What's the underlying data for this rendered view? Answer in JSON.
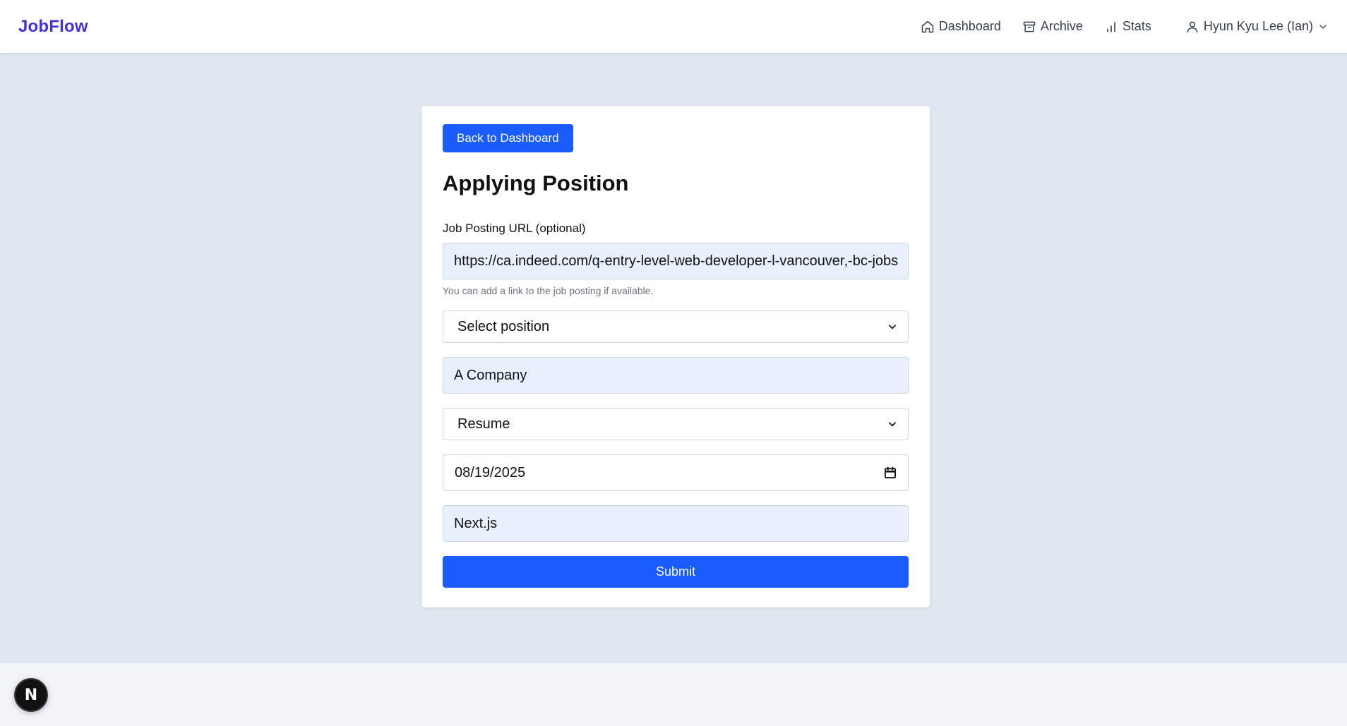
{
  "app": {
    "brand": "JobFlow"
  },
  "nav": {
    "dashboard": "Dashboard",
    "archive": "Archive",
    "stats": "Stats",
    "user": "Hyun Kyu Lee (Ian)"
  },
  "card": {
    "back_button": "Back to Dashboard",
    "title": "Applying Position",
    "url_label": "Job Posting URL (optional)",
    "url_value": "https://ca.indeed.com/q-entry-level-web-developer-l-vancouver,-bc-jobs",
    "url_hint": "You can add a link to the job posting if available.",
    "position_select": "Select position",
    "company_value": "A Company",
    "resume_select": "Resume",
    "date_value": "08/19/2025",
    "tech_value": "Next.js",
    "submit_button": "Submit"
  },
  "badge": {
    "label": "N"
  },
  "colors": {
    "brand": "#4332d6",
    "primary_button": "#1a5cff",
    "page_background": "#e1e7f0",
    "autofill_background": "#e8effd"
  },
  "icons": [
    "home-icon",
    "archive-icon",
    "stats-icon",
    "user-icon",
    "chevron-down-icon",
    "calendar-icon"
  ]
}
